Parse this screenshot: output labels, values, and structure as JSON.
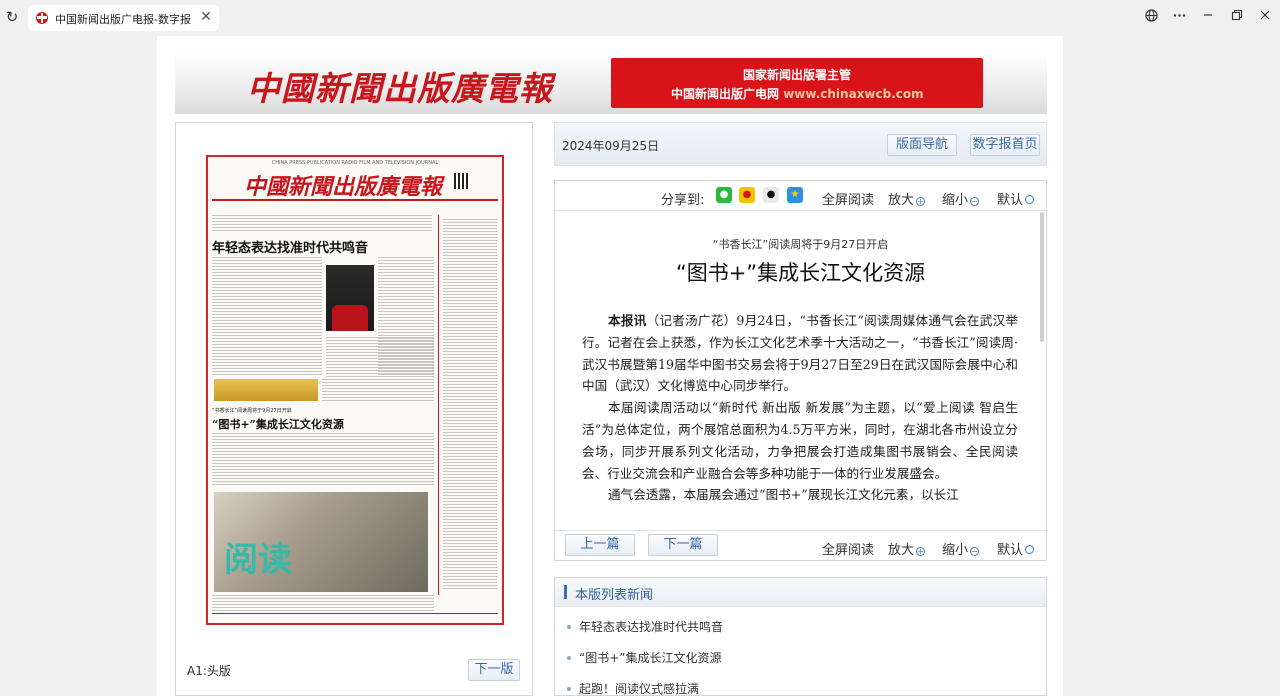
{
  "browser": {
    "tab_title": "中国新闻出版广电报-数字报",
    "reload_glyph": "↻",
    "close_glyph": "✕",
    "icons": [
      "reload-icon",
      "globe-icon",
      "more-icon",
      "minimize-icon",
      "restore-icon",
      "close-icon"
    ]
  },
  "masthead": {
    "logo": "中國新聞出版廣電報",
    "banner_line1": "国家新闻出版署主管",
    "banner_line2": "中国新闻出版广电网",
    "banner_url": "www.chinaxwcb.com"
  },
  "paper": {
    "english_title": "CHINA PRESS PUBLICATION RADIO FILM AND TELEVISION JOURNAL",
    "mast": "中國新聞出版廣電報",
    "lead_headline": "年轻态表达找准时代共鸣音",
    "second_sub": "“书香长江”阅读周将于9月27日开启",
    "second_headline": "“图书+”集成长江文化资源",
    "photo_text": "阅读",
    "page_label": "A1:头版",
    "next_page": "下一版"
  },
  "nav": {
    "date": "2024年09月25日",
    "layout_nav": "版面导航",
    "home": "数字报首页"
  },
  "article": {
    "share_label": "分享到:",
    "share_icons": [
      "wechat-icon",
      "weibo-icon",
      "qq-icon",
      "qzone-icon"
    ],
    "fullscreen": "全屏阅读",
    "zoom_in": "放大",
    "zoom_out": "缩小",
    "default": "默认",
    "pretitle": "“书香长江”阅读周将于9月27日开启",
    "title": "“图书+”集成长江文化资源",
    "para1_lead": "本报讯",
    "para1": "（记者汤广花）9月24日，“书香长江”阅读周媒体通气会在武汉举行。记者在会上获悉，作为长江文化艺术季十大活动之一，“书香长江”阅读周·武汉书展暨第19届华中图书交易会将于9月27日至29日在武汉国际会展中心和中国（武汉）文化博览中心同步举行。",
    "para2": "本届阅读周活动以“新时代 新出版 新发展”为主题，以“爱上阅读 智启生活”为总体定位，两个展馆总面积为4.5万平方米，同时，在湖北各市州设立分会场，同步开展系列文化活动，力争把展会打造成集图书展销会、全民阅读会、行业交流会和产业融合会等多种功能于一体的行业发展盛会。",
    "para3": "通气会透露，本届展会通过“图书+”展现长江文化元素，以长江",
    "prev": "上一篇",
    "next": "下一篇"
  },
  "list": {
    "title": "本版列表新闻",
    "items": [
      "年轻态表达找准时代共鸣音",
      "“图书+”集成长江文化资源",
      "起跑！阅读仪式感拉满"
    ]
  },
  "colors": {
    "brand_red": "#c8161d",
    "banner_red": "#d8131a",
    "link_blue": "#3869a6"
  }
}
